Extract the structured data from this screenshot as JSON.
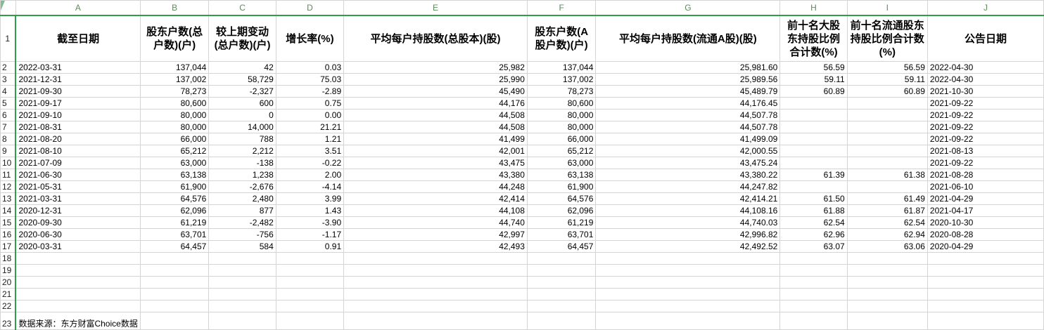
{
  "columns": [
    "A",
    "B",
    "C",
    "D",
    "E",
    "F",
    "G",
    "H",
    "I",
    "J"
  ],
  "headers": [
    "截至日期",
    "股东户数(总户数)(户)",
    "较上期变动(总户数)(户)",
    "增长率(%)",
    "平均每户持股数(总股本)(股)",
    "股东户数(A股户数)(户)",
    "平均每户持股数(流通A股)(股)",
    "前十名大股东持股比例合计数(%)",
    "前十名流通股东持股比例合计数(%)",
    "公告日期"
  ],
  "rows": [
    [
      "2022-03-31",
      "137,044",
      "42",
      "0.03",
      "25,982",
      "137,044",
      "25,981.60",
      "56.59",
      "56.59",
      "2022-04-30"
    ],
    [
      "2021-12-31",
      "137,002",
      "58,729",
      "75.03",
      "25,990",
      "137,002",
      "25,989.56",
      "59.11",
      "59.11",
      "2022-04-30"
    ],
    [
      "2021-09-30",
      "78,273",
      "-2,327",
      "-2.89",
      "45,490",
      "78,273",
      "45,489.79",
      "60.89",
      "60.89",
      "2021-10-30"
    ],
    [
      "2021-09-17",
      "80,600",
      "600",
      "0.75",
      "44,176",
      "80,600",
      "44,176.45",
      "",
      "",
      "2021-09-22"
    ],
    [
      "2021-09-10",
      "80,000",
      "0",
      "0.00",
      "44,508",
      "80,000",
      "44,507.78",
      "",
      "",
      "2021-09-22"
    ],
    [
      "2021-08-31",
      "80,000",
      "14,000",
      "21.21",
      "44,508",
      "80,000",
      "44,507.78",
      "",
      "",
      "2021-09-22"
    ],
    [
      "2021-08-20",
      "66,000",
      "788",
      "1.21",
      "41,499",
      "66,000",
      "41,499.09",
      "",
      "",
      "2021-09-22"
    ],
    [
      "2021-08-10",
      "65,212",
      "2,212",
      "3.51",
      "42,001",
      "65,212",
      "42,000.55",
      "",
      "",
      "2021-08-13"
    ],
    [
      "2021-07-09",
      "63,000",
      "-138",
      "-0.22",
      "43,475",
      "63,000",
      "43,475.24",
      "",
      "",
      "2021-09-22"
    ],
    [
      "2021-06-30",
      "63,138",
      "1,238",
      "2.00",
      "43,380",
      "63,138",
      "43,380.22",
      "61.39",
      "61.38",
      "2021-08-28"
    ],
    [
      "2021-05-31",
      "61,900",
      "-2,676",
      "-4.14",
      "44,248",
      "61,900",
      "44,247.82",
      "",
      "",
      "2021-06-10"
    ],
    [
      "2021-03-31",
      "64,576",
      "2,480",
      "3.99",
      "42,414",
      "64,576",
      "42,414.21",
      "61.50",
      "61.49",
      "2021-04-29"
    ],
    [
      "2020-12-31",
      "62,096",
      "877",
      "1.43",
      "44,108",
      "62,096",
      "44,108.16",
      "61.88",
      "61.87",
      "2021-04-17"
    ],
    [
      "2020-09-30",
      "61,219",
      "-2,482",
      "-3.90",
      "44,740",
      "61,219",
      "44,740.03",
      "62.54",
      "62.54",
      "2020-10-30"
    ],
    [
      "2020-06-30",
      "63,701",
      "-756",
      "-1.17",
      "42,997",
      "63,701",
      "42,996.82",
      "62.96",
      "62.94",
      "2020-08-28"
    ],
    [
      "2020-03-31",
      "64,457",
      "584",
      "0.91",
      "42,493",
      "64,457",
      "42,492.52",
      "63.07",
      "63.06",
      "2020-04-29"
    ]
  ],
  "row_numbers": [
    "1",
    "2",
    "3",
    "4",
    "5",
    "6",
    "7",
    "8",
    "9",
    "10",
    "11",
    "12",
    "13",
    "14",
    "15",
    "16",
    "17",
    "18",
    "19",
    "20",
    "21",
    "22",
    "23"
  ],
  "empty_rows": [
    "18",
    "19",
    "20",
    "21",
    "22"
  ],
  "source_note": "数据来源：东方财富Choice数据",
  "colors": {
    "grid": "#d4d4d4",
    "accent": "#2f9e4b",
    "col_header_text": "#5b8a5b"
  }
}
